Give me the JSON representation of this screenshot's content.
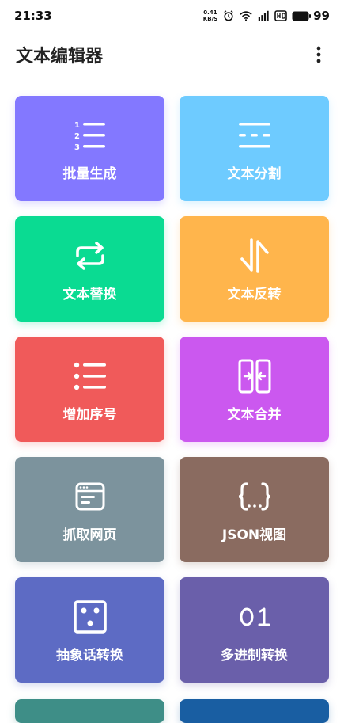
{
  "status_bar": {
    "time": "21:33",
    "net_speed_value": "0.41",
    "net_speed_unit": "KB/S",
    "battery_level": "99"
  },
  "app_bar": {
    "title": "文本编辑器"
  },
  "tiles": [
    {
      "label": "批量生成",
      "icon": "numbered-list-icon",
      "color": "#8378FF"
    },
    {
      "label": "文本分割",
      "icon": "split-lines-icon",
      "color": "#6ECBFF"
    },
    {
      "label": "文本替换",
      "icon": "swap-arrows-icon",
      "color": "#0ADB92"
    },
    {
      "label": "文本反转",
      "icon": "reverse-arrows-icon",
      "color": "#FFB54C"
    },
    {
      "label": "增加序号",
      "icon": "bullet-list-icon",
      "color": "#F05A5A"
    },
    {
      "label": "文本合并",
      "icon": "merge-icon",
      "color": "#CB58EF"
    },
    {
      "label": "抓取网页",
      "icon": "browser-window-icon",
      "color": "#7C939D"
    },
    {
      "label": "JSON视图",
      "icon": "json-braces-icon",
      "color": "#8A6B60"
    },
    {
      "label": "抽象话转换",
      "icon": "dice-face-icon",
      "color": "#5D6BC4"
    },
    {
      "label": "多进制转换",
      "icon": "binary-digits-icon",
      "color": "#6A5FAA"
    }
  ],
  "partial_tiles": [
    {
      "color": "#3E8E87"
    },
    {
      "color": "#195EA2"
    }
  ]
}
